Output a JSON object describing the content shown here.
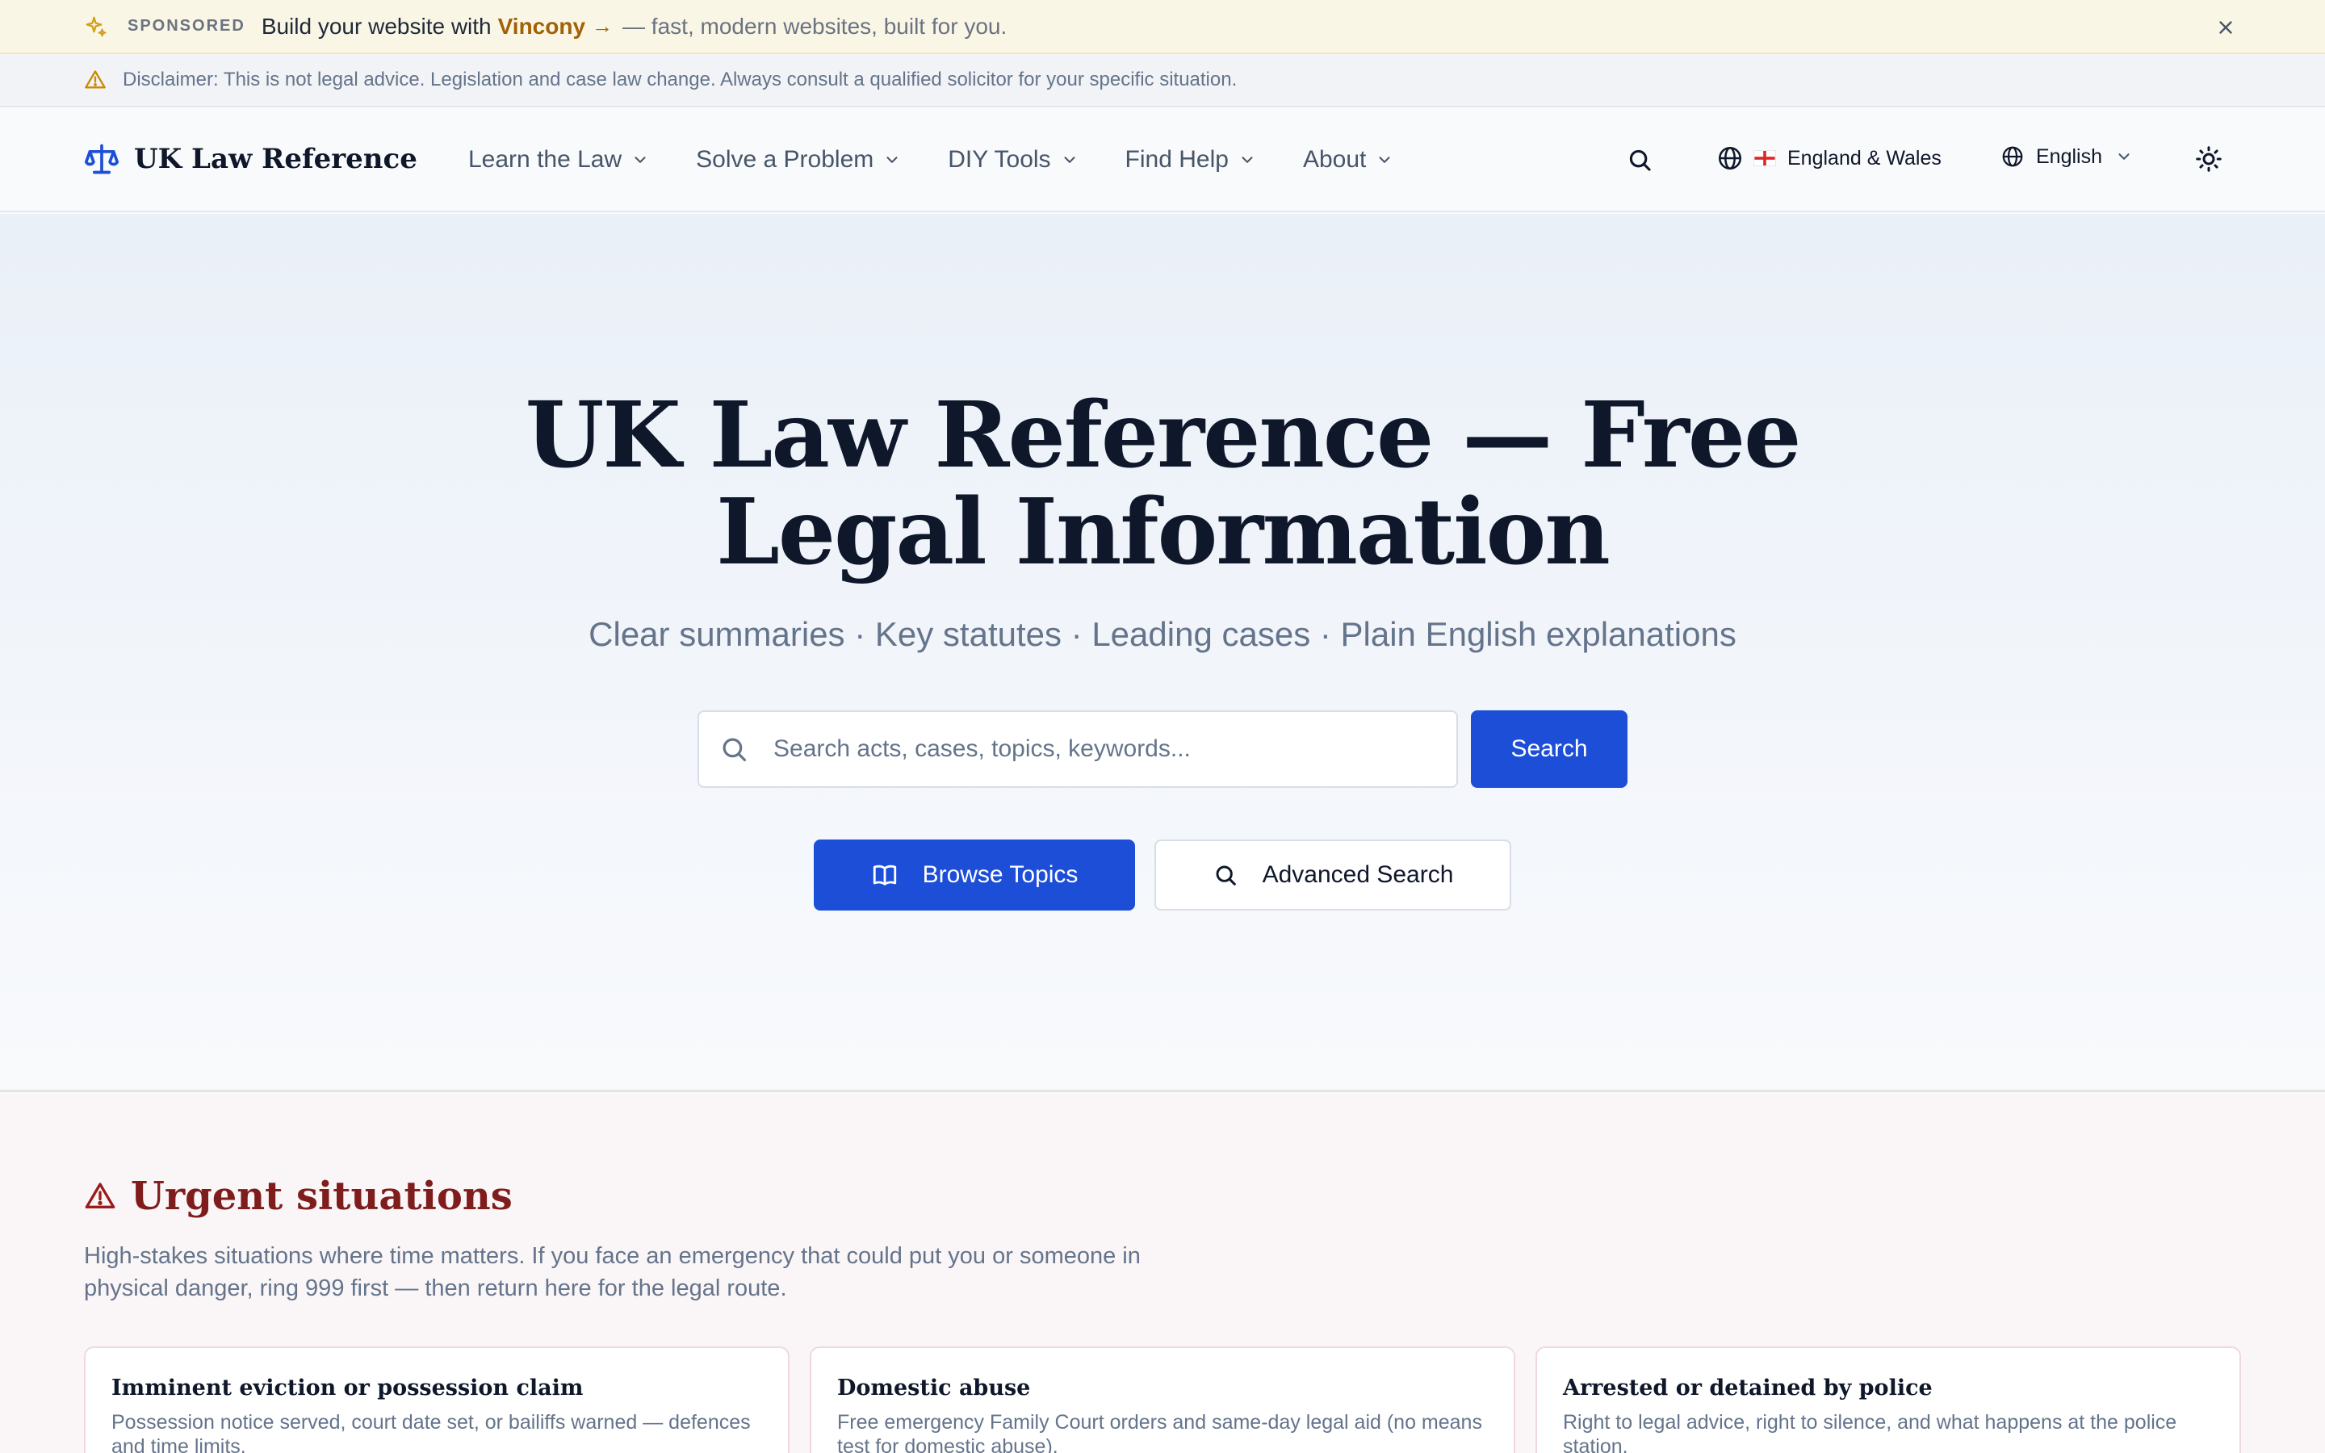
{
  "sponsor": {
    "tag": "SPONSORED",
    "message": "Build your website with",
    "brand": "Vincony",
    "arrow": "→",
    "tail": "— fast, modern websites, built for you."
  },
  "disclaimer": {
    "text": "Disclaimer: This is not legal advice. Legislation and case law change. Always consult a qualified solicitor for your specific situation."
  },
  "nav": {
    "logo": "UK Law Reference",
    "items": [
      {
        "label": "Learn the Law"
      },
      {
        "label": "Solve a Problem"
      },
      {
        "label": "DIY Tools"
      },
      {
        "label": "Find Help"
      },
      {
        "label": "About"
      }
    ],
    "region": "England & Wales",
    "language": "English"
  },
  "hero": {
    "title": "UK Law Reference — Free Legal Information",
    "subtitle": "Clear summaries · Key statutes · Leading cases · Plain English explanations",
    "search_placeholder": "Search acts, cases, topics, keywords...",
    "search_button": "Search",
    "browse_button": "Browse Topics",
    "advanced_button": "Advanced Search"
  },
  "urgent": {
    "title": "Urgent situations",
    "description": "High-stakes situations where time matters. If you face an emergency that could put you or someone in physical danger, ring 999 first — then return here for the legal route.",
    "cards": [
      {
        "title": "Imminent eviction or possession claim",
        "text": "Possession notice served, court date set, or bailiffs warned — defences and time limits."
      },
      {
        "title": "Domestic abuse",
        "text": "Free emergency Family Court orders and same-day legal aid (no means test for domestic abuse)."
      },
      {
        "title": "Arrested or detained by police",
        "text": "Right to legal advice, right to silence, and what happens at the police station."
      }
    ]
  },
  "colors": {
    "primary": "#1d4ed8",
    "urgent": "#7f1d1d",
    "sponsor_brand": "#a16207"
  }
}
